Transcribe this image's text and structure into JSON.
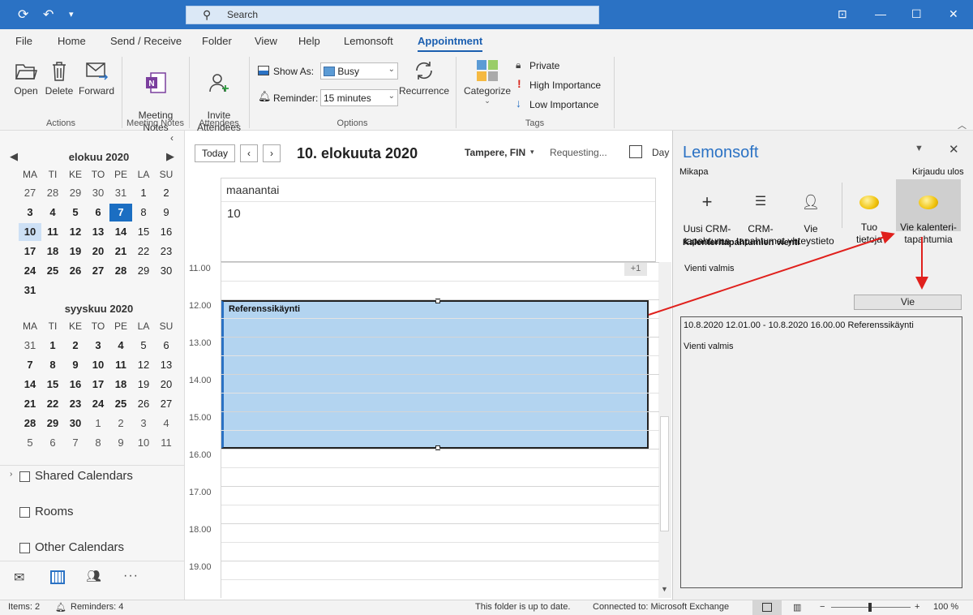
{
  "titlebar": {
    "search_placeholder": "Search"
  },
  "menu": {
    "tabs": [
      "File",
      "Home",
      "Send / Receive",
      "Folder",
      "View",
      "Help",
      "Lemonsoft",
      "Appointment"
    ]
  },
  "ribbon": {
    "actions": {
      "open": "Open",
      "delete": "Delete",
      "forward": "Forward",
      "group": "Actions"
    },
    "meeting_notes": {
      "label": "Meeting\nNotes",
      "group": "Meeting Notes"
    },
    "attendees": {
      "label": "Invite\nAttendees",
      "group": "Attendees"
    },
    "options": {
      "show_as_label": "Show As:",
      "show_as_value": "Busy",
      "reminder_label": "Reminder:",
      "reminder_value": "15 minutes",
      "recurrence": "Recurrence",
      "group": "Options"
    },
    "tags": {
      "categorize": "Categorize",
      "private": "Private",
      "high": "High Importance",
      "low": "Low Importance",
      "group": "Tags"
    }
  },
  "minical": {
    "dow": [
      "MA",
      "TI",
      "KE",
      "TO",
      "PE",
      "LA",
      "SU"
    ],
    "aug_title": "elokuu 2020",
    "aug_weeks": [
      [
        "27",
        "28",
        "29",
        "30",
        "31",
        "1",
        "2"
      ],
      [
        "3",
        "4",
        "5",
        "6",
        "7",
        "8",
        "9"
      ],
      [
        "10",
        "11",
        "12",
        "13",
        "14",
        "15",
        "16"
      ],
      [
        "17",
        "18",
        "19",
        "20",
        "21",
        "22",
        "23"
      ],
      [
        "24",
        "25",
        "26",
        "27",
        "28",
        "29",
        "30"
      ],
      [
        "31",
        "",
        "",
        "",
        "",
        "",
        ""
      ]
    ],
    "sep_title": "syyskuu 2020",
    "sep_weeks": [
      [
        "31",
        "1",
        "2",
        "3",
        "4",
        "5",
        "6"
      ],
      [
        "7",
        "8",
        "9",
        "10",
        "11",
        "12",
        "13"
      ],
      [
        "14",
        "15",
        "16",
        "17",
        "18",
        "19",
        "20"
      ],
      [
        "21",
        "22",
        "23",
        "24",
        "25",
        "26",
        "27"
      ],
      [
        "28",
        "29",
        "30",
        "1",
        "2",
        "3",
        "4"
      ],
      [
        "5",
        "6",
        "7",
        "8",
        "9",
        "10",
        "11"
      ]
    ]
  },
  "calendar_groups": [
    "Shared Calendars",
    "Rooms",
    "Other Calendars"
  ],
  "calendar": {
    "today_btn": "Today",
    "date_title": "10. elokuuta 2020",
    "location": "Tampere, FIN",
    "weather": "Requesting...",
    "view": "Day",
    "day_name": "maanantai",
    "day_num": "10",
    "more": "+1",
    "hours": [
      "11.00",
      "12.00",
      "13.00",
      "14.00",
      "15.00",
      "16.00",
      "17.00",
      "18.00",
      "19.00"
    ],
    "event_title": "Referenssikäynti"
  },
  "lemonsoft": {
    "title": "Lemonsoft",
    "user": "Mikapa",
    "logout": "Kirjaudu ulos",
    "buttons": [
      "Uusi CRM-\ntapahtuma",
      "CRM-\ntapahtumat",
      "Vie\nyhteystieto",
      "Tuo\ntietoja",
      "Vie kalenteri-\ntapahtumia"
    ],
    "section_title": "Kalenteritapahtumien vienti",
    "status": "Vienti valmis",
    "export_btn": "Vie",
    "log_line1": "10.8.2020 12.01.00 - 10.8.2020 16.00.00 Referenssikäynti",
    "log_line2": "Vienti valmis"
  },
  "statusbar": {
    "items": "Items: 2",
    "reminders": "Reminders: 4",
    "folder": "This folder is up to date.",
    "connected": "Connected to: Microsoft Exchange",
    "zoom": "100 %"
  },
  "colors": {
    "accent": "#2b72c4",
    "event": "#b3d4f0",
    "selected_day": "#1b6ec2",
    "arrow": "#e0201c"
  }
}
